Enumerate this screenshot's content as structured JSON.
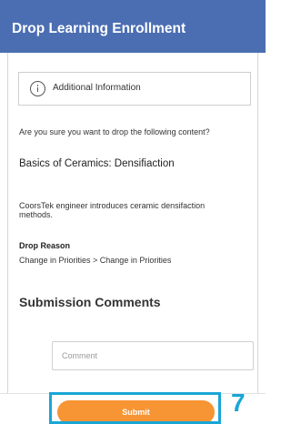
{
  "header": {
    "title": "Drop Learning Enrollment"
  },
  "info": {
    "icon": "info-icon",
    "label": "Additional Information"
  },
  "confirmation": {
    "question": "Are you sure you want to drop the following content?",
    "content_title": "Basics of Ceramics: Densifiaction",
    "description": "CoorsTek engineer introduces ceramic densifaction methods."
  },
  "drop_reason": {
    "label": "Drop Reason",
    "value": "Change in Priorities > Change in Priorities"
  },
  "submission": {
    "heading": "Submission Comments",
    "comment_placeholder": "Comment",
    "comment_value": ""
  },
  "footer": {
    "submit_label": "Submit",
    "step_number": "7"
  },
  "colors": {
    "header_bg": "#4b6eb3",
    "submit_bg": "#f79433",
    "highlight": "#19a6d6"
  }
}
